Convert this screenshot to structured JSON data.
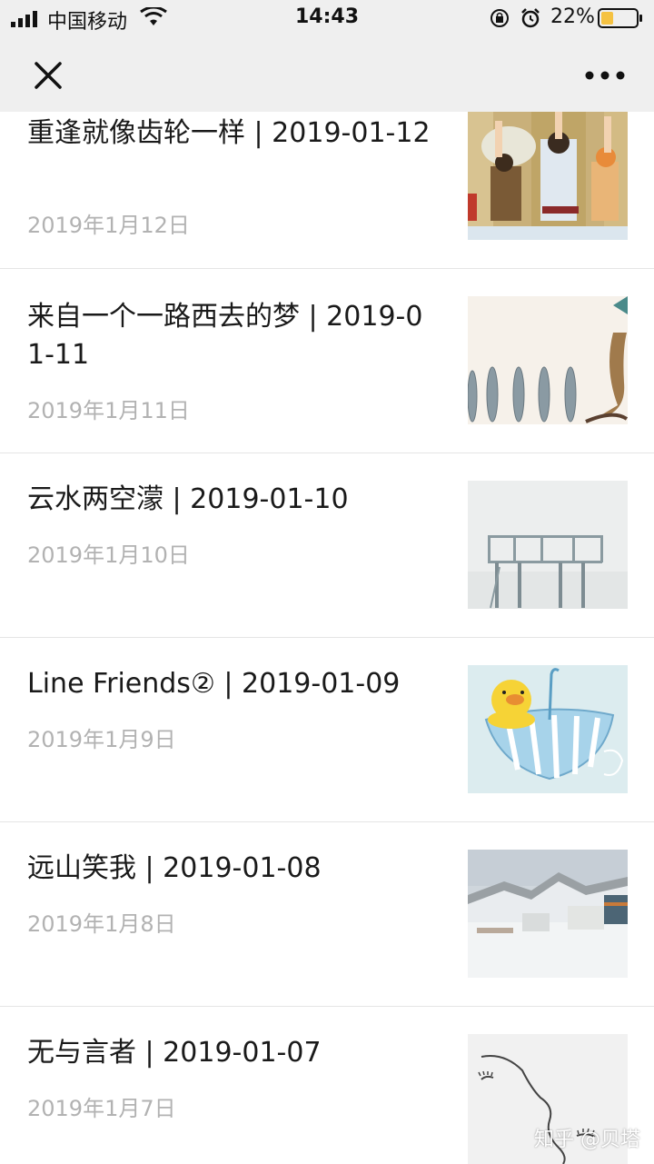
{
  "status_bar": {
    "carrier": "中国移动",
    "time": "14:43",
    "battery_percent": "22%",
    "battery_level": 0.22,
    "battery_color": "#f5c242"
  },
  "nav": {
    "close_icon": "close-icon",
    "more_icon": "more-icon"
  },
  "articles": [
    {
      "title": "重逢就像齿轮一样 | 2019-01-12",
      "date": "2019年1月12日",
      "thumb": "anime-characters-thumbnail"
    },
    {
      "title": "来自一个一路西去的梦 | 2019-01-11",
      "date": "2019年1月11日",
      "thumb": "fish-and-cat-thumbnail"
    },
    {
      "title": "云水两空濛 | 2019-01-10",
      "date": "2019年1月10日",
      "thumb": "misty-pier-thumbnail"
    },
    {
      "title": "Line Friends② | 2019-01-09",
      "date": "2019年1月9日",
      "thumb": "duck-umbrella-thumbnail"
    },
    {
      "title": "远山笑我 | 2019-01-08",
      "date": "2019年1月8日",
      "thumb": "snowy-mountain-thumbnail"
    },
    {
      "title": "无与言者 | 2019-01-07",
      "date": "2019年1月7日",
      "thumb": "line-drawing-thumbnail"
    }
  ],
  "watermark": "知乎 @贝塔"
}
